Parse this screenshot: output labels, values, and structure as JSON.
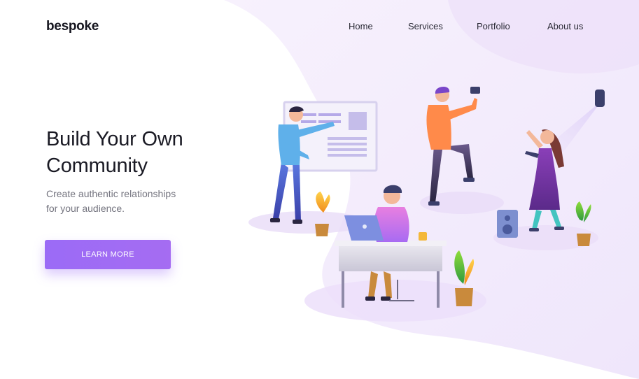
{
  "brand": {
    "logo_text": "bespoke"
  },
  "nav": {
    "items": [
      {
        "label": "Home"
      },
      {
        "label": "Services"
      },
      {
        "label": "Portfolio"
      },
      {
        "label": "About us"
      }
    ]
  },
  "hero": {
    "title": "Build Your Own\nCommunity",
    "subtitle": "Create authentic relationships\nfor your audience.",
    "cta_label": "LEARN MORE"
  },
  "colors": {
    "accent": "#9b6bf6",
    "background_blob": "#f3ecfb",
    "text_dark": "#1a1a24",
    "text_muted": "#74747f"
  },
  "illustration": {
    "description_icon": "community-team-illustration"
  }
}
